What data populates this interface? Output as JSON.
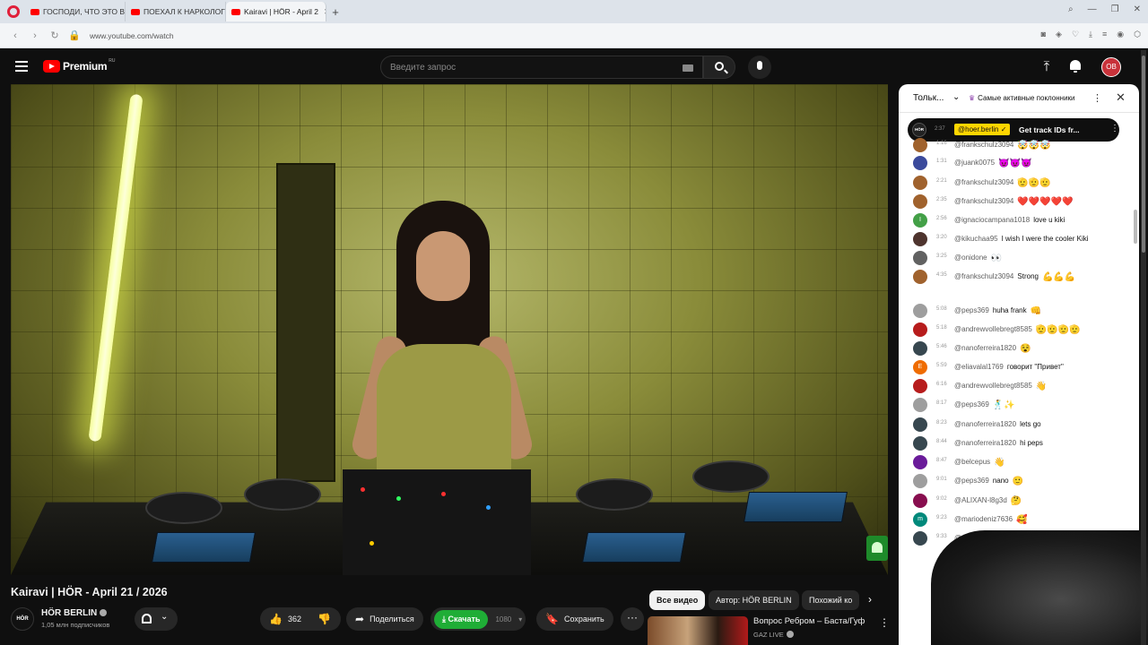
{
  "browser": {
    "tabs": [
      {
        "title": "ГОСПОДИ, ЧТО ЭТО ВОО"
      },
      {
        "title": "ПОЕХАЛ К НАРКОЛОГУ"
      },
      {
        "title": "Kairavi | HÖR - April 2"
      }
    ],
    "new_tab": "+",
    "url": "www.youtube.com/watch"
  },
  "header": {
    "logo_text": "Premium",
    "region": "RU",
    "search_placeholder": "Введите запрос",
    "avatar_initials": "OB"
  },
  "video": {
    "title": "Kairavi | HÖR - April 21 / 2026",
    "channel": "HÖR BERLIN",
    "channel_avatar_text": "HÖR",
    "subscribers": "1,05 млн подписчиков",
    "likes": "362",
    "share_label": "Поделиться",
    "download_label": "Скачать",
    "download_quality": "1080",
    "save_label": "Сохранить",
    "more_label": "···"
  },
  "recommendations": {
    "chips": [
      "Все видео",
      "Автор: HÖR BERLIN",
      "Похожий ко"
    ],
    "first": {
      "title": "Вопрос Ребром – Баста/Гуф",
      "channel": "GAZ LIVE"
    }
  },
  "chat": {
    "mode": "Тольк...",
    "fans_label": "Самые активные поклонники",
    "pinned": {
      "avatar_text": "HÖR",
      "time": "2:37",
      "author": "@hoer.berlin ✓",
      "text": "Get track IDs fr..."
    },
    "messages": [
      {
        "time": "1:16",
        "author": "@frankschulz3094",
        "text": "",
        "emoji": "🤯🤯🤯",
        "color": "#a0622d",
        "initial": ""
      },
      {
        "time": "1:31",
        "author": "@juank0075",
        "text": "",
        "emoji": "😈😈😈",
        "color": "#3b4a9c",
        "initial": ""
      },
      {
        "time": "2:21",
        "author": "@frankschulz3094",
        "text": "",
        "emoji": "🫡🫡🫡",
        "color": "#a0622d",
        "initial": ""
      },
      {
        "time": "2:35",
        "author": "@frankschulz3094",
        "text": "",
        "emoji": "❤️❤️❤️❤️❤️",
        "color": "#a0622d",
        "initial": ""
      },
      {
        "time": "2:56",
        "author": "@ignaciocampana1018",
        "text": "love u kiki",
        "emoji": "",
        "color": "#43a047",
        "initial": "I"
      },
      {
        "time": "3:20",
        "author": "@kikuchaa95",
        "text": "I wish I were the cooler Kiki",
        "emoji": "",
        "color": "#4e342e",
        "initial": ""
      },
      {
        "time": "3:25",
        "author": "@onidone",
        "text": "",
        "emoji": "👀",
        "color": "#616161",
        "initial": ""
      },
      {
        "time": "4:35",
        "author": "@frankschulz3094",
        "text": "Strong",
        "emoji": "💪💪💪",
        "color": "#a0622d",
        "initial": ""
      },
      {
        "time": "5:08",
        "author": "@peps369",
        "text": "huha frank",
        "emoji": "👊",
        "color": "#9e9e9e",
        "initial": ""
      },
      {
        "time": "5:18",
        "author": "@andrewvollebregt8585",
        "text": "",
        "emoji": "🫡🫡🫡🫡",
        "color": "#b71c1c",
        "initial": ""
      },
      {
        "time": "5:46",
        "author": "@nanoferreira1820",
        "text": "",
        "emoji": "😵",
        "color": "#37474f",
        "initial": ""
      },
      {
        "time": "5:59",
        "author": "@eliavalal1769",
        "text": "говорит \"Привет\"",
        "emoji": "",
        "color": "#ef6c00",
        "initial": "E"
      },
      {
        "time": "6:16",
        "author": "@andrewvollebregt8585",
        "text": "",
        "emoji": "👋",
        "color": "#b71c1c",
        "initial": ""
      },
      {
        "time": "8:17",
        "author": "@peps369",
        "text": "",
        "emoji": "🕺✨",
        "color": "#9e9e9e",
        "initial": ""
      },
      {
        "time": "8:23",
        "author": "@nanoferreira1820",
        "text": "lets go",
        "emoji": "",
        "color": "#37474f",
        "initial": ""
      },
      {
        "time": "8:44",
        "author": "@nanoferreira1820",
        "text": "hi peps",
        "emoji": "",
        "color": "#37474f",
        "initial": ""
      },
      {
        "time": "8:47",
        "author": "@belcepus",
        "text": "",
        "emoji": "👋",
        "color": "#6a1b9a",
        "initial": ""
      },
      {
        "time": "9:01",
        "author": "@peps369",
        "text": "nano",
        "emoji": "🙂",
        "color": "#9e9e9e",
        "initial": ""
      },
      {
        "time": "9:02",
        "author": "@ALIXAN-l8g3d",
        "text": "",
        "emoji": "🤔",
        "color": "#880e4f",
        "initial": ""
      },
      {
        "time": "9:23",
        "author": "@mariodeniz7636",
        "text": "",
        "emoji": "🥰",
        "color": "#00897b",
        "initial": "m"
      },
      {
        "time": "9:33",
        "author": "@nanof",
        "text": "",
        "emoji": "",
        "color": "#37474f",
        "initial": ""
      }
    ]
  },
  "colors": {
    "accent_red": "#ff0000",
    "download_green": "#1fad36",
    "pinned_yellow": "#ffd600"
  }
}
